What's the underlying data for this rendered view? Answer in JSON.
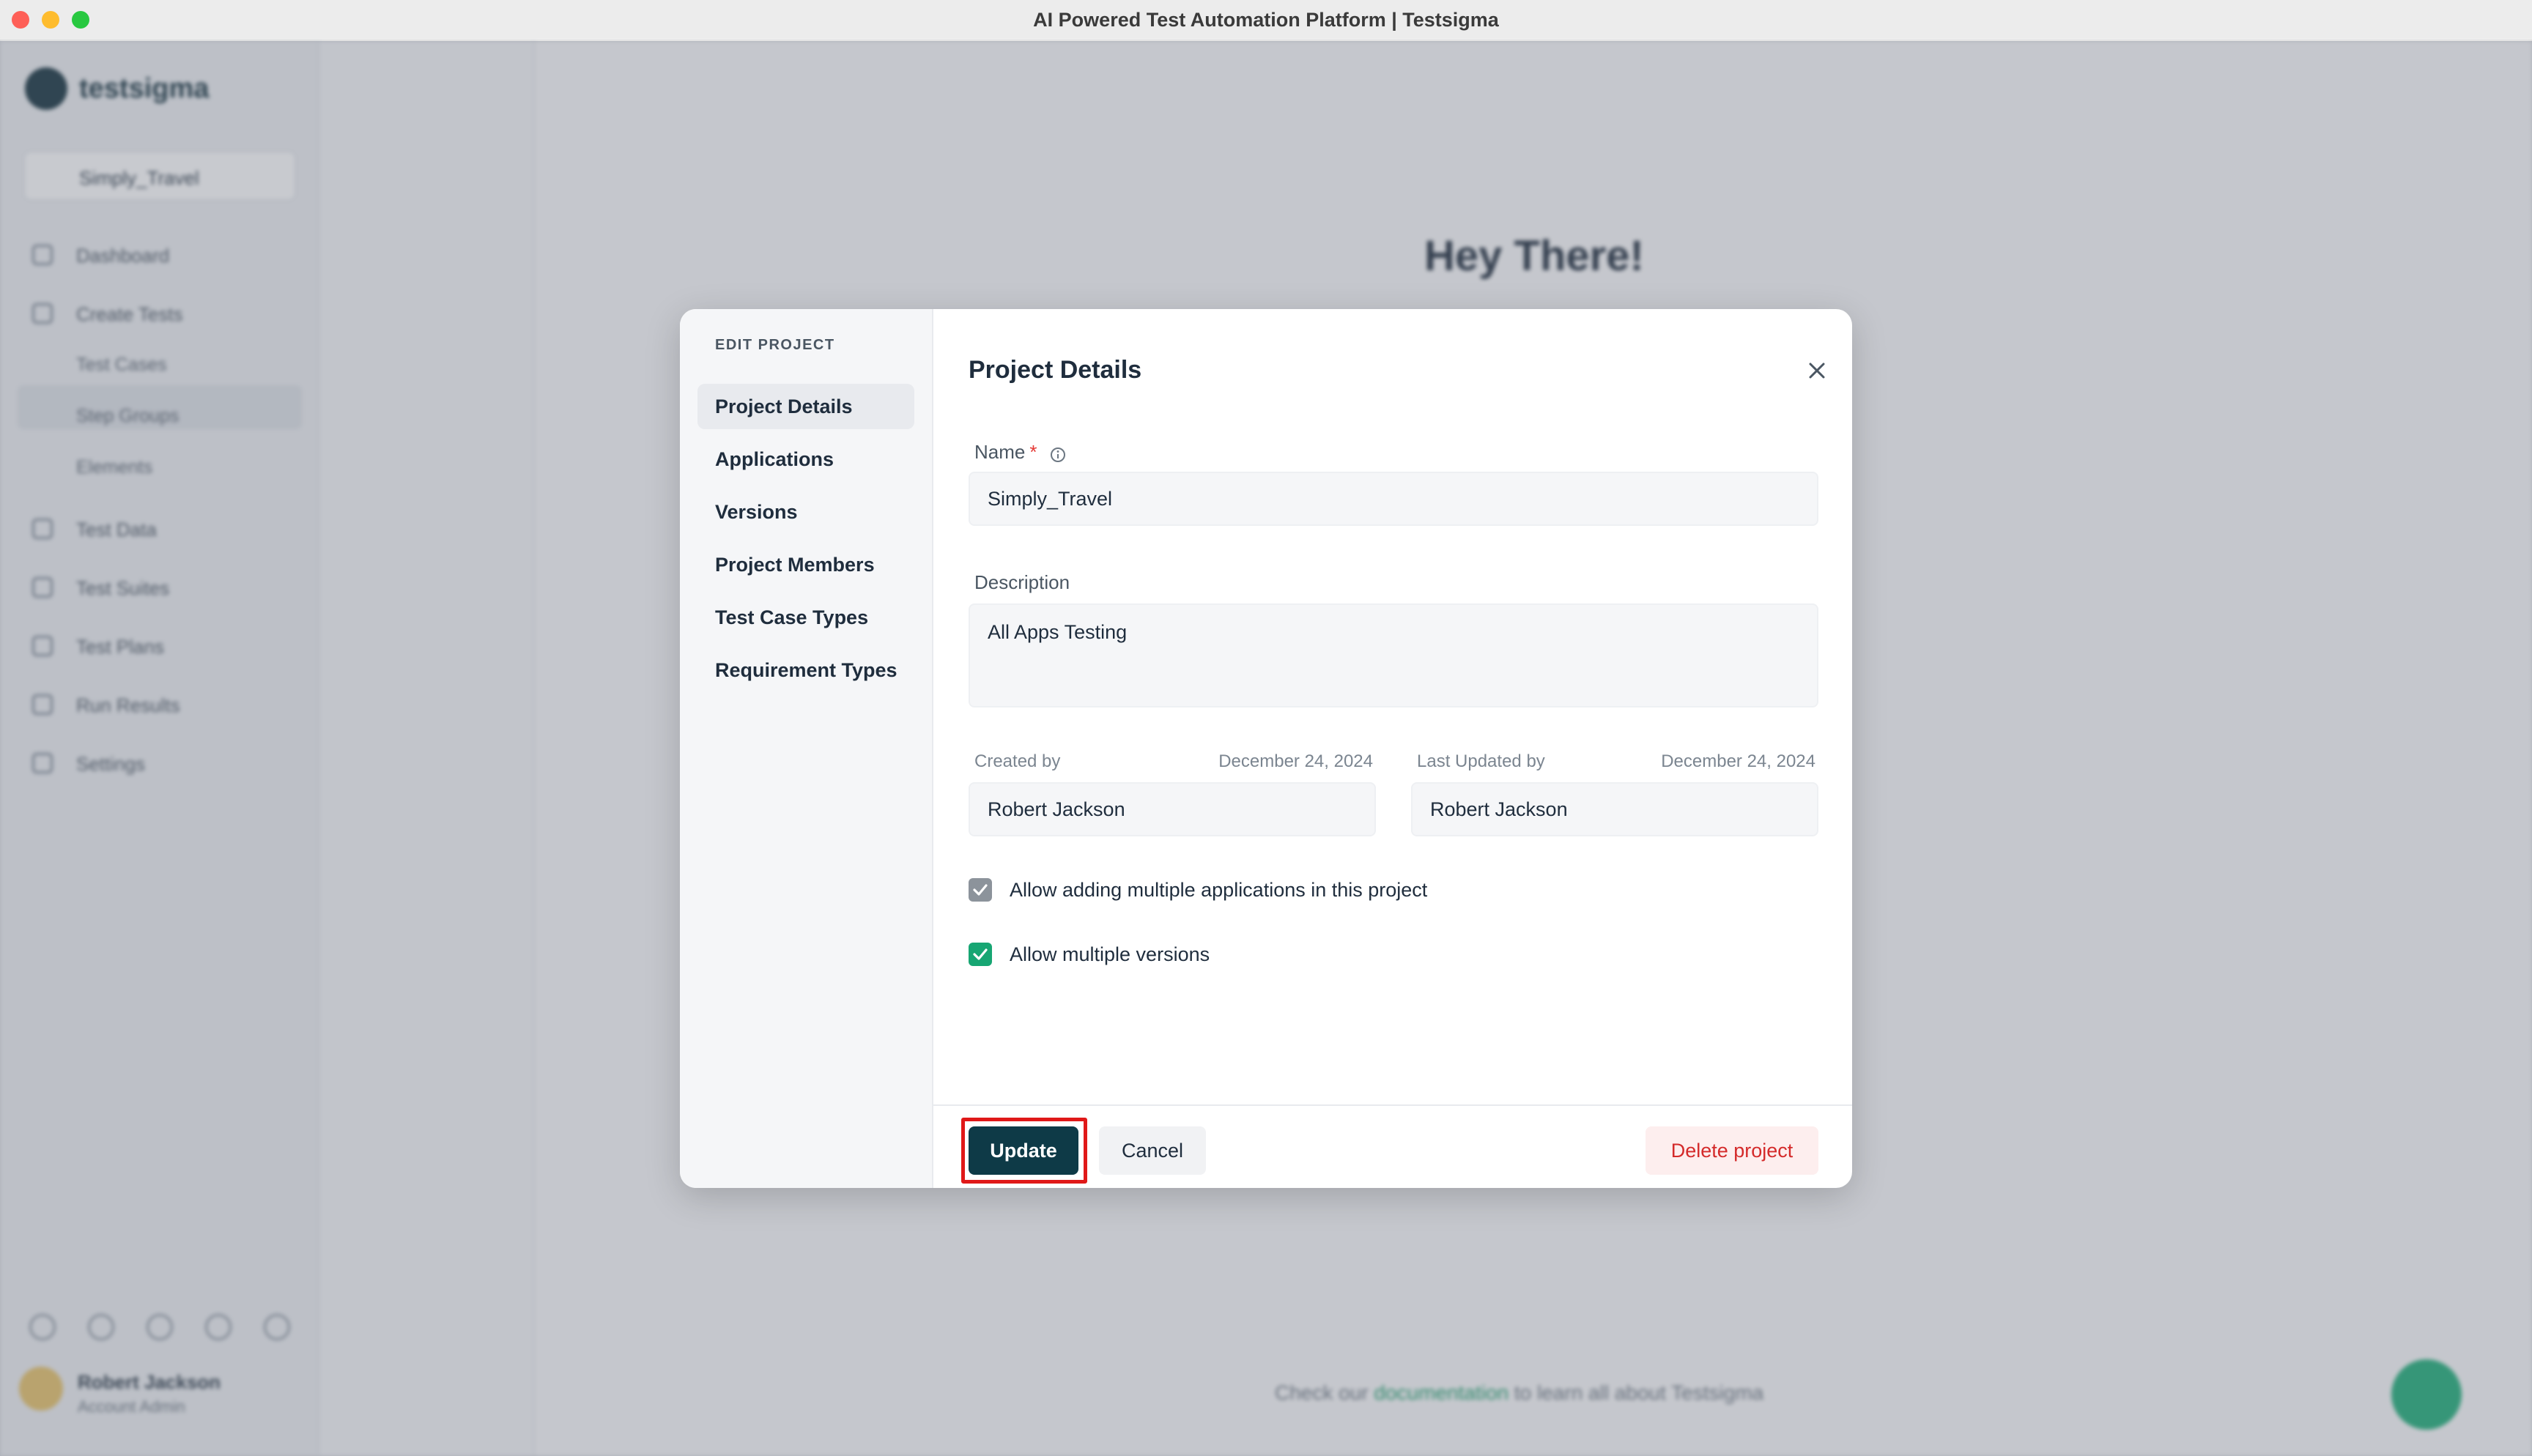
{
  "window": {
    "title": "AI Powered Test Automation Platform | Testsigma"
  },
  "background_app": {
    "logo_text": "testsigma",
    "project_selector": "Simply_Travel",
    "nav": [
      "Dashboard",
      "Create Tests",
      "Test Cases",
      "Step Groups",
      "Elements",
      "Test Data",
      "Test Suites",
      "Test Plans",
      "Run Results",
      "Settings"
    ],
    "user_name": "Robert Jackson",
    "user_role": "Account Admin",
    "heading": "Hey There!",
    "help_prefix": "Check our",
    "help_link": "documentation",
    "help_suffix": "to learn all about Testsigma"
  },
  "modal": {
    "side_heading": "EDIT PROJECT",
    "side_items": [
      {
        "label": "Project Details",
        "active": true
      },
      {
        "label": "Applications",
        "active": false
      },
      {
        "label": "Versions",
        "active": false
      },
      {
        "label": "Project Members",
        "active": false
      },
      {
        "label": "Test Case Types",
        "active": false
      },
      {
        "label": "Requirement Types",
        "active": false
      }
    ],
    "title": "Project Details",
    "close_icon": "close-icon",
    "name_label": "Name",
    "required_marker": "*",
    "name_value": "Simply_Travel",
    "description_label": "Description",
    "description_value": "All Apps Testing",
    "created_by_label": "Created by",
    "created_date": "December 24, 2024",
    "created_by_value": "Robert Jackson",
    "updated_by_label": "Last Updated by",
    "updated_date": "December 24, 2024",
    "updated_by_value": "Robert Jackson",
    "checkbox_multi_apps": {
      "label": "Allow adding multiple applications in this project",
      "checked": true,
      "color": "#8c939b"
    },
    "checkbox_multi_versions": {
      "label": "Allow multiple versions",
      "checked": true,
      "color": "#17a673"
    },
    "buttons": {
      "update": "Update",
      "cancel": "Cancel",
      "delete": "Delete project"
    }
  },
  "colors": {
    "primary": "#0e3a47",
    "danger": "#d42a2a",
    "success": "#17a673",
    "highlight": "#e01818"
  }
}
